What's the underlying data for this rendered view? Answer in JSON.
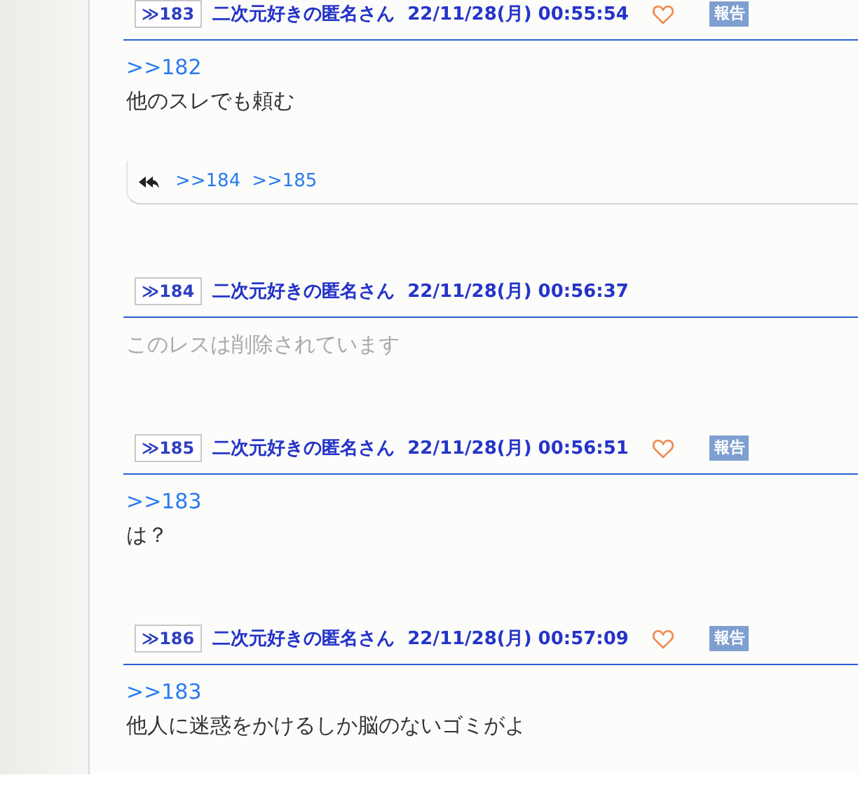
{
  "posts": [
    {
      "kind": "normal",
      "number": "≫183",
      "name": "二次元好きの匿名さん",
      "date": "22/11/28(月) 00:55:54",
      "report": "報告",
      "anchor": ">>182",
      "text": "他のスレでも頼む",
      "replies": [
        ">>184",
        ">>185"
      ]
    },
    {
      "kind": "deleted",
      "number": "≫184",
      "name": "二次元好きの匿名さん",
      "date": "22/11/28(月) 00:56:37",
      "text": "このレスは削除されています"
    },
    {
      "kind": "normal",
      "number": "≫185",
      "name": "二次元好きの匿名さん",
      "date": "22/11/28(月) 00:56:51",
      "report": "報告",
      "anchor": ">>183",
      "text": "は？"
    },
    {
      "kind": "normal",
      "number": "≫186",
      "name": "二次元好きの匿名さん",
      "date": "22/11/28(月) 00:57:09",
      "report": "報告",
      "anchor": ">>183",
      "text": "他人に迷惑をかけるしか脳のないゴミがよ"
    }
  ]
}
